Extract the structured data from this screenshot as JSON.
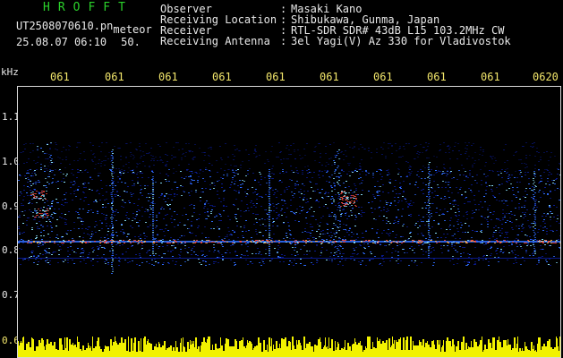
{
  "header": {
    "app_title": "HROFFT",
    "file_name": "UT2508070610.pn",
    "mode": "meteor",
    "date_time": "25.08.07 06:10",
    "duration": "50.",
    "meta_rows": [
      {
        "label": "Observer",
        "value": "Masaki Kano"
      },
      {
        "label": "Receiving Location",
        "value": "Shibukawa, Gunma, Japan"
      },
      {
        "label": "Receiver",
        "value": "RTL-SDR SDR# 43dB L15 103.2MHz CW"
      },
      {
        "label": "Receiving Antenna",
        "value": "3el Yagi(V) Az 330 for Vladivostok"
      }
    ]
  },
  "axes": {
    "freq_unit": "kHz",
    "freq_ticks": [
      "1.1",
      "1.0",
      "0.9",
      "0.8",
      "0.7",
      "0.6"
    ],
    "time_ticks": [
      "061",
      "061",
      "061",
      "061",
      "061",
      "061",
      "061",
      "061",
      "061",
      "0620"
    ]
  },
  "colors": {
    "title": "#2bd12b",
    "time_ticks": "#f2e66b",
    "text": "#e8e8e8",
    "background": "#000000",
    "spectrum_low": "#0a1a8f",
    "spectrum_mid": "#2f6dff",
    "spectrum_high": "#8fe6ff",
    "spectrum_peak": "#ff4a3a",
    "bottom_histogram": "#ffff00"
  }
}
